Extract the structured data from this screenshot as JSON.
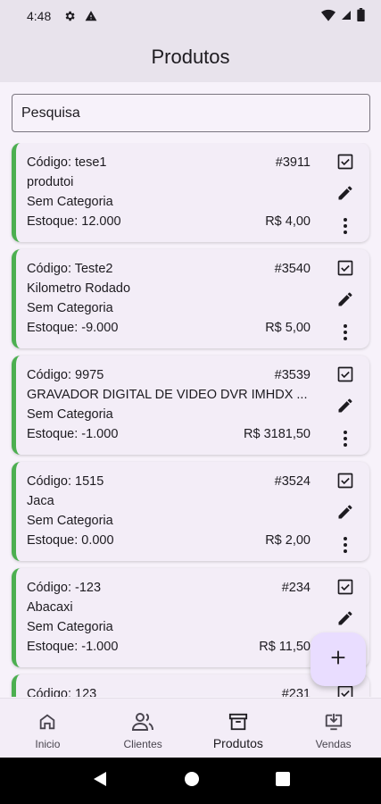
{
  "status": {
    "time": "4:48"
  },
  "appbar": {
    "title": "Produtos"
  },
  "search": {
    "placeholder": "Pesquisa"
  },
  "products": [
    {
      "code": "Código: tese1",
      "id": "#3911",
      "name": "produtoi",
      "category": "Sem Categoria",
      "stock": "Estoque: 12.000",
      "price": "R$ 4,00"
    },
    {
      "code": "Código: Teste2",
      "id": "#3540",
      "name": "Kilometro Rodado",
      "category": "Sem Categoria",
      "stock": "Estoque: -9.000",
      "price": "R$ 5,00"
    },
    {
      "code": "Código: 9975",
      "id": "#3539",
      "name": "GRAVADOR DIGITAL DE VIDEO DVR IMHDX ...",
      "category": "Sem Categoria",
      "stock": "Estoque: -1.000",
      "price": "R$ 3181,50"
    },
    {
      "code": "Código: 1515",
      "id": "#3524",
      "name": "Jaca",
      "category": "Sem Categoria",
      "stock": "Estoque: 0.000",
      "price": "R$ 2,00"
    },
    {
      "code": "Código: -123",
      "id": "#234",
      "name": "Abacaxi",
      "category": "Sem Categoria",
      "stock": "Estoque: -1.000",
      "price": "R$ 11,50"
    },
    {
      "code": "Código: 123",
      "id": "#231",
      "name": "",
      "category": "",
      "stock": "",
      "price": ""
    }
  ],
  "nav": {
    "items": [
      {
        "label": "Inicio",
        "icon": "home-icon"
      },
      {
        "label": "Clientes",
        "icon": "people-icon"
      },
      {
        "label": "Produtos",
        "icon": "archive-box-icon"
      },
      {
        "label": "Vendas",
        "icon": "download-monitor-icon"
      }
    ],
    "active": 2
  },
  "colors": {
    "accent_stripe": "#4caf50",
    "fab_bg": "#e9ddff",
    "background": "#f7f2fa"
  }
}
